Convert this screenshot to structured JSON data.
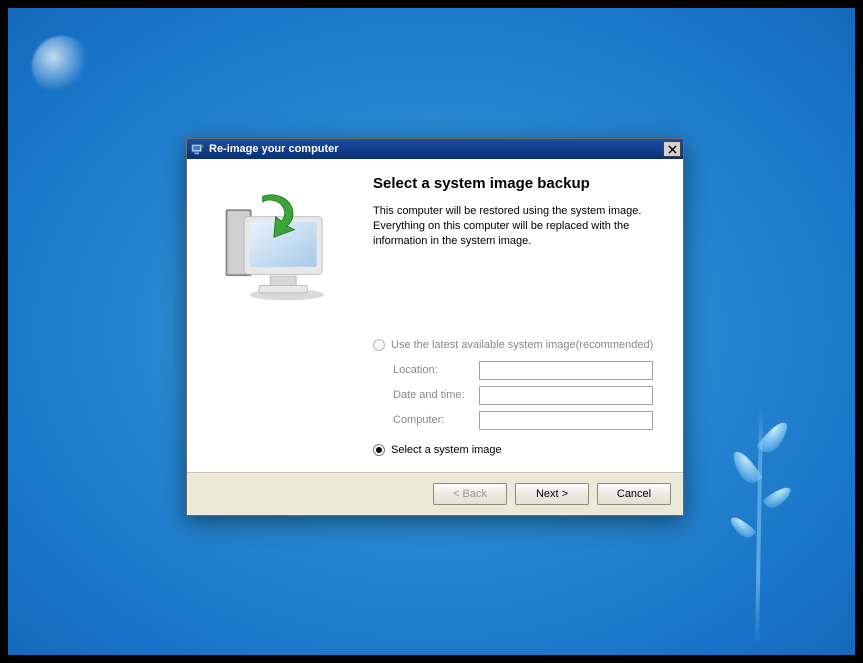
{
  "window": {
    "title": "Re-image your computer",
    "close_icon": "close-icon"
  },
  "main": {
    "heading": "Select a system image backup",
    "description": "This computer will be restored using the system image. Everything on this computer will be replaced with the information in the system image."
  },
  "options": {
    "latest": {
      "label": "Use the latest available system image(recommended)",
      "enabled": false,
      "selected": false
    },
    "manual": {
      "label": "Select a system image",
      "enabled": true,
      "selected": true
    },
    "fields": {
      "location_label": "Location:",
      "location_value": "",
      "datetime_label": "Date and time:",
      "datetime_value": "",
      "computer_label": "Computer:",
      "computer_value": ""
    }
  },
  "buttons": {
    "back": "< Back",
    "next": "Next >",
    "cancel": "Cancel"
  },
  "colors": {
    "titlebar_start": "#1b4ea5",
    "titlebar_end": "#0a2e74",
    "dialog_bg": "#ece9d8"
  }
}
